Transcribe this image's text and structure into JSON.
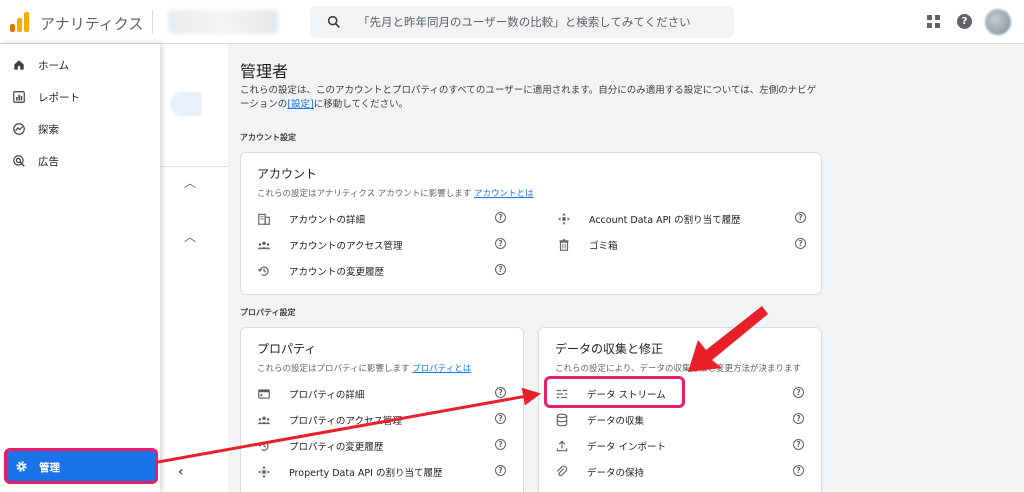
{
  "header": {
    "app_title": "アナリティクス",
    "search_placeholder": "「先月と昨年同月のユーザー数の比較」と検索してみてください"
  },
  "sidebar": {
    "items": [
      {
        "label": "ホーム",
        "icon": "home-icon"
      },
      {
        "label": "レポート",
        "icon": "reports-icon"
      },
      {
        "label": "探索",
        "icon": "explore-icon"
      },
      {
        "label": "広告",
        "icon": "advertising-icon"
      }
    ],
    "admin_label": "管理",
    "collapse_glyph": "‹"
  },
  "main": {
    "title": "管理者",
    "description_1": "これらの設定は、このアカウントとプロパティのすべてのユーザーに適用されます。自分にのみ適用する設定については、左側のナビゲーションの",
    "description_link": "[設定]",
    "description_2": "に移動してください。",
    "account_section_label": "アカウント設定",
    "property_section_label": "プロパティ設定"
  },
  "account_card": {
    "title": "アカウント",
    "subtitle": "これらの設定はアナリティクス アカウントに影響します",
    "subtitle_link": "アカウントとは",
    "left_items": [
      {
        "label": "アカウントの詳細",
        "icon": "building-icon"
      },
      {
        "label": "アカウントのアクセス管理",
        "icon": "people-icon"
      },
      {
        "label": "アカウントの変更履歴",
        "icon": "history-icon"
      }
    ],
    "right_items": [
      {
        "label": "Account Data API の割り当て履歴",
        "icon": "api-icon"
      },
      {
        "label": "ゴミ箱",
        "icon": "trash-icon"
      }
    ]
  },
  "property_card": {
    "title": "プロパティ",
    "subtitle": "これらの設定はプロパティに影響します",
    "subtitle_link": "プロパティとは",
    "items": [
      {
        "label": "プロパティの詳細",
        "icon": "property-details-icon"
      },
      {
        "label": "プロパティのアクセス管理",
        "icon": "people-icon"
      },
      {
        "label": "プロパティの変更履歴",
        "icon": "history-icon"
      },
      {
        "label": "Property Data API の割り当て履歴",
        "icon": "api-icon"
      }
    ]
  },
  "data_card": {
    "title": "データの収集と修正",
    "subtitle": "これらの設定により、データの収集方法と変更方法が決まります",
    "items": [
      {
        "label": "データ ストリーム",
        "icon": "data-streams-icon"
      },
      {
        "label": "データの収集",
        "icon": "database-icon"
      },
      {
        "label": "データ インポート",
        "icon": "upload-icon"
      },
      {
        "label": "データの保持",
        "icon": "retention-icon"
      }
    ]
  },
  "help_glyph": "?",
  "colors": {
    "accent": "#1a73e8",
    "highlight": "#e91e63",
    "arrow": "#e8202a"
  }
}
